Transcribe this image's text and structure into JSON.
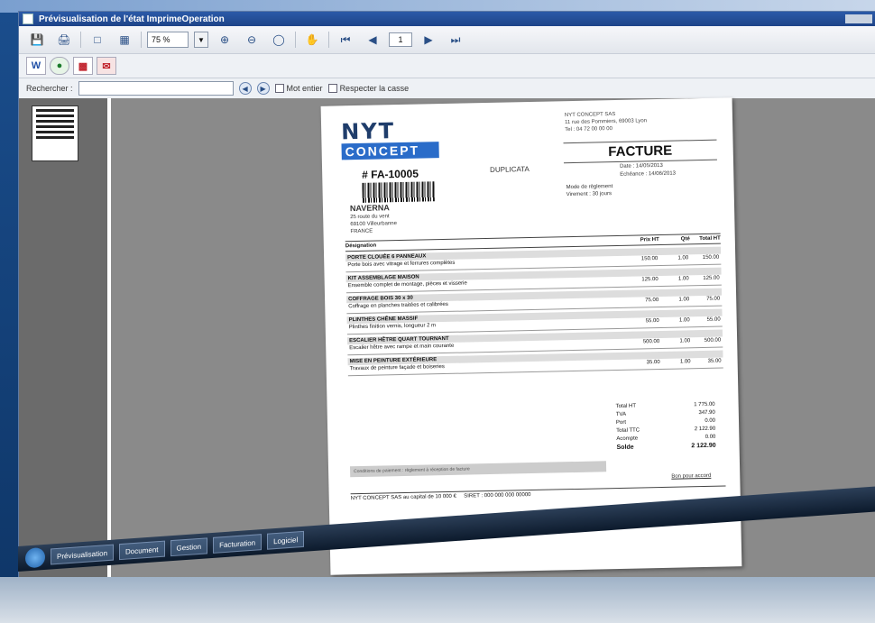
{
  "window": {
    "title": "Prévisualisation de l'état ImprimeOperation"
  },
  "toolbar": {
    "zoom_value": "75 %",
    "page_value": "1"
  },
  "searchbar": {
    "label": "Rechercher :",
    "option1": "Mot entier",
    "option2": "Respecter la casse"
  },
  "invoice": {
    "logo_top": "NYT",
    "logo_bottom": "CONCEPT",
    "number": "# FA-10005",
    "exemplaire": "DUPLICATA",
    "company_lines": [
      "NYT CONCEPT SAS",
      "11 rue des Pommiers, 69003 Lyon",
      "Tel : 04 72 00 00 00"
    ],
    "doc_title": "FACTURE",
    "meta_lines": [
      "Date : 14/05/2013",
      "Echéance : 14/06/2013"
    ],
    "client_name": "NAVERNA",
    "client_lines": [
      "25 route du vent",
      "69100 Villeurbanne",
      "FRANCE"
    ],
    "mode_lines": [
      "Mode de règlement",
      "Virement : 30 jours"
    ],
    "table_headers": [
      "Désignation",
      "Prix HT",
      "Qté",
      "Total HT"
    ],
    "rows": [
      {
        "group": "PORTE CLOUÉE 6 PANNEAUX",
        "desc": "Porte bois avec vitrage et ferrures complètes",
        "price": "150.00",
        "qty": "1.00",
        "total": "150.00"
      },
      {
        "group": "KIT ASSEMBLAGE MAISON",
        "desc": "Ensemble complet de montage, pièces et visserie",
        "price": "125.00",
        "qty": "1.00",
        "total": "125.00"
      },
      {
        "group": "COFFRAGE BOIS 30 x 30",
        "desc": "Coffrage en planches traitées et calibrées",
        "price": "75.00",
        "qty": "1.00",
        "total": "75.00"
      },
      {
        "group": "PLINTHES CHÊNE MASSIF",
        "desc": "Plinthes finition vernis, longueur 2 m",
        "price": "55.00",
        "qty": "1.00",
        "total": "55.00"
      },
      {
        "group": "ESCALIER HÊTRE QUART TOURNANT",
        "desc": "Escalier hêtre avec rampe et main courante",
        "price": "500.00",
        "qty": "1.00",
        "total": "500.00"
      },
      {
        "group": "MISE EN PEINTURE EXTÉRIEURE",
        "desc": "Travaux de peinture façade et boiseries",
        "price": "35.00",
        "qty": "1.00",
        "total": "35.00"
      }
    ],
    "totals": [
      {
        "label": "Total HT",
        "value": "1 775.00"
      },
      {
        "label": "TVA",
        "value": "347.90"
      },
      {
        "label": "Port",
        "value": "0.00"
      },
      {
        "label": "Total TTC",
        "value": "2 122.90"
      },
      {
        "label": "Acompte",
        "value": "0.00"
      },
      {
        "label": "Solde",
        "value": "2 122.90"
      }
    ],
    "greybar_text": "Conditions de paiement : règlement à réception de facture",
    "sign_text": "Bon pour accord",
    "footer_left": "NYT CONCEPT SAS au capital de 10 000 €",
    "footer_mid": "SIRET : 000 000 000 00000"
  },
  "taskbar": {
    "tasks": [
      "Prévisualisation",
      "Document",
      "Gestion",
      "Facturation",
      "Logiciel"
    ]
  }
}
